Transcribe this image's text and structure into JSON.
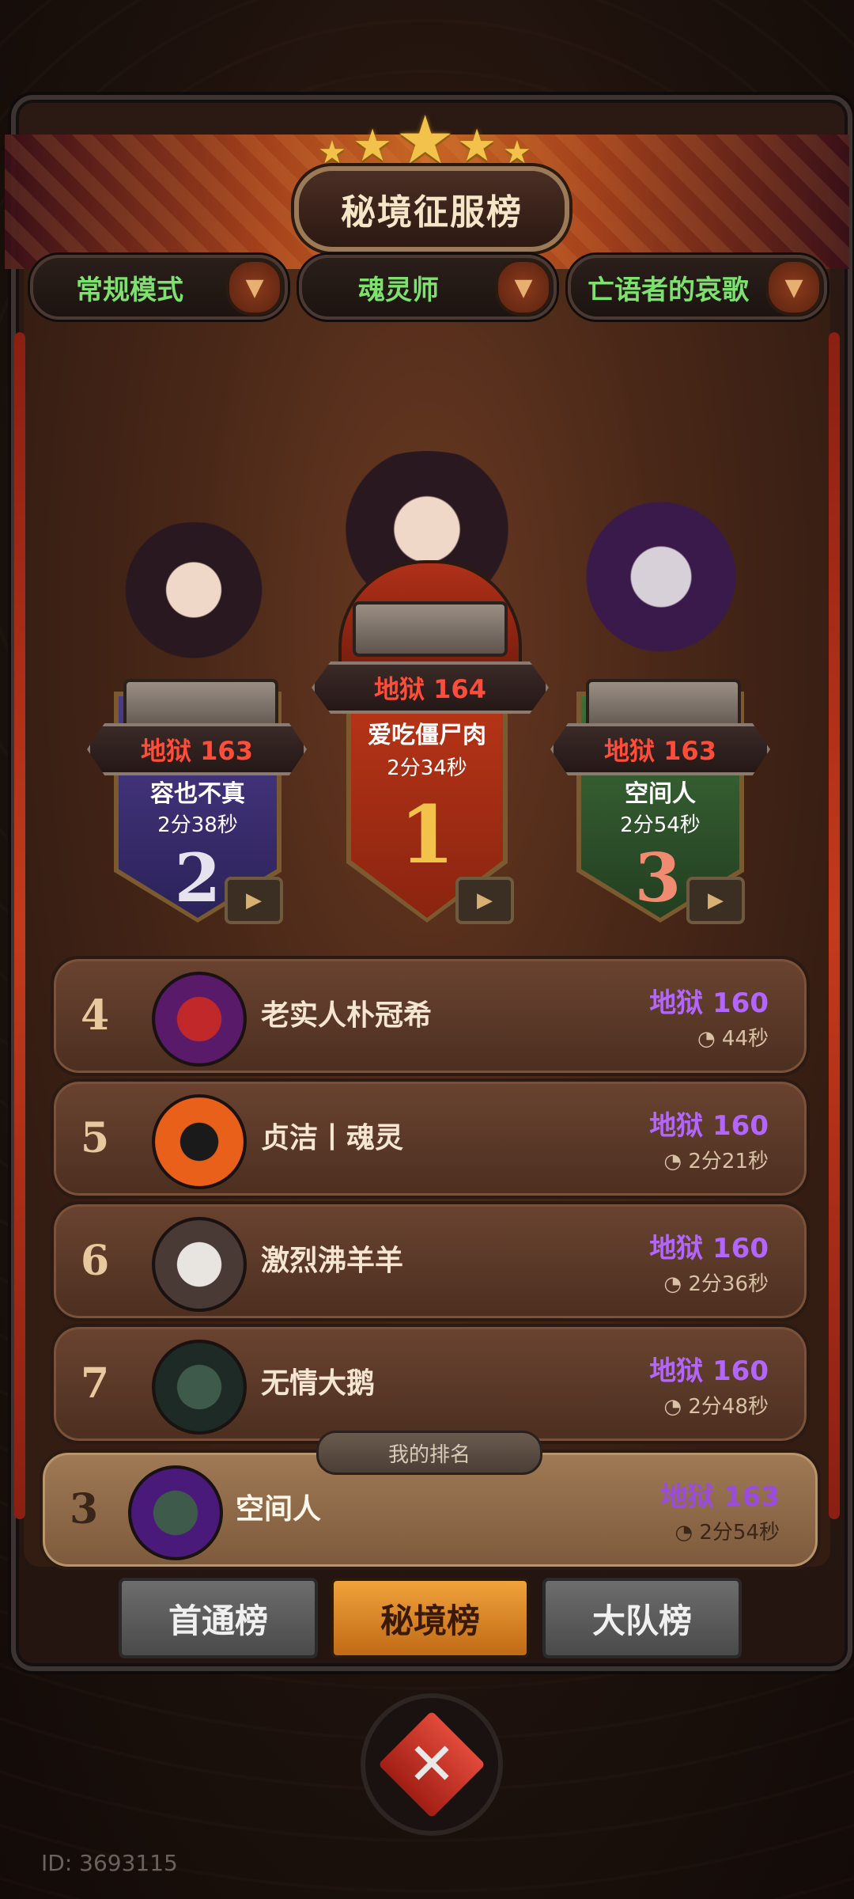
{
  "header": {
    "title": "秘境征服榜",
    "stars": 5
  },
  "filters": {
    "mode": "常规模式",
    "class": "魂灵师",
    "dungeon": "亡语者的哀歌"
  },
  "podium": [
    {
      "rank": "2",
      "level": "地狱 163",
      "name": "容也不真",
      "time": "2分38秒"
    },
    {
      "rank": "1",
      "level": "地狱 164",
      "name": "爱吃僵尸肉",
      "time": "2分34秒"
    },
    {
      "rank": "3",
      "level": "地狱 163",
      "name": "空间人",
      "time": "2分54秒"
    }
  ],
  "list": [
    {
      "rank": "4",
      "name": "老实人朴冠希",
      "level": "地狱 160",
      "time": "44秒"
    },
    {
      "rank": "5",
      "name": "贞洁丨魂灵",
      "level": "地狱 160",
      "time": "2分21秒"
    },
    {
      "rank": "6",
      "name": "激烈沸羊羊",
      "level": "地狱 160",
      "time": "2分36秒"
    },
    {
      "rank": "7",
      "name": "无情大鹅",
      "level": "地狱 160",
      "time": "2分48秒"
    }
  ],
  "my_rank": {
    "tag": "我的排名",
    "rank": "3",
    "name": "空间人",
    "level": "地狱 163",
    "time": "2分54秒"
  },
  "tabs": [
    {
      "label": "首通榜",
      "active": false
    },
    {
      "label": "秘境榜",
      "active": true
    },
    {
      "label": "大队榜",
      "active": false
    }
  ],
  "footer": {
    "id_text": "ID: 3693115"
  },
  "colors": {
    "accent_green": "#7ee06e",
    "level_purple": "#b266ff",
    "level_red": "#ff4d3a",
    "tab_active": "#f0a23a"
  }
}
